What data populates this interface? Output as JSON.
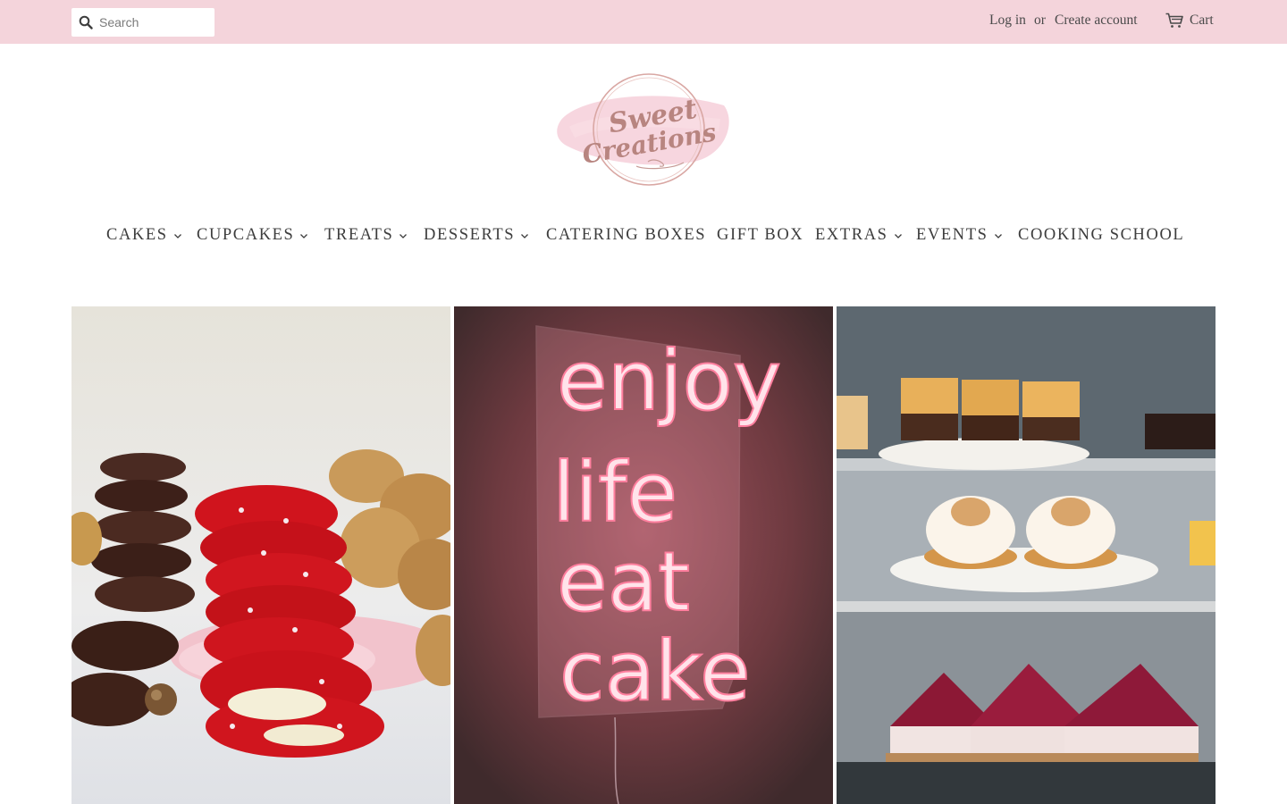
{
  "header": {
    "search_placeholder": "Search",
    "login_label": "Log in",
    "or_label": "or",
    "create_account_label": "Create account",
    "cart_label": "Cart",
    "cart_icon": "cart-icon",
    "search_icon": "search-icon"
  },
  "brand": {
    "logo_line1": "Sweet",
    "logo_line2": "Creations",
    "accent_color": "#f4d4db"
  },
  "nav": {
    "items": [
      {
        "label": "CAKES",
        "has_dropdown": true
      },
      {
        "label": "CUPCAKES",
        "has_dropdown": true
      },
      {
        "label": "TREATS",
        "has_dropdown": true
      },
      {
        "label": "DESSERTS",
        "has_dropdown": true
      },
      {
        "label": "CATERING BOXES",
        "has_dropdown": false
      },
      {
        "label": "GIFT BOX",
        "has_dropdown": false
      },
      {
        "label": "EXTRAS",
        "has_dropdown": true
      },
      {
        "label": "EVENTS",
        "has_dropdown": true
      },
      {
        "label": "COOKING SCHOOL",
        "has_dropdown": false
      }
    ]
  },
  "gallery": {
    "neon_sign": [
      "enjoy",
      "life",
      "eat",
      "cake"
    ]
  }
}
